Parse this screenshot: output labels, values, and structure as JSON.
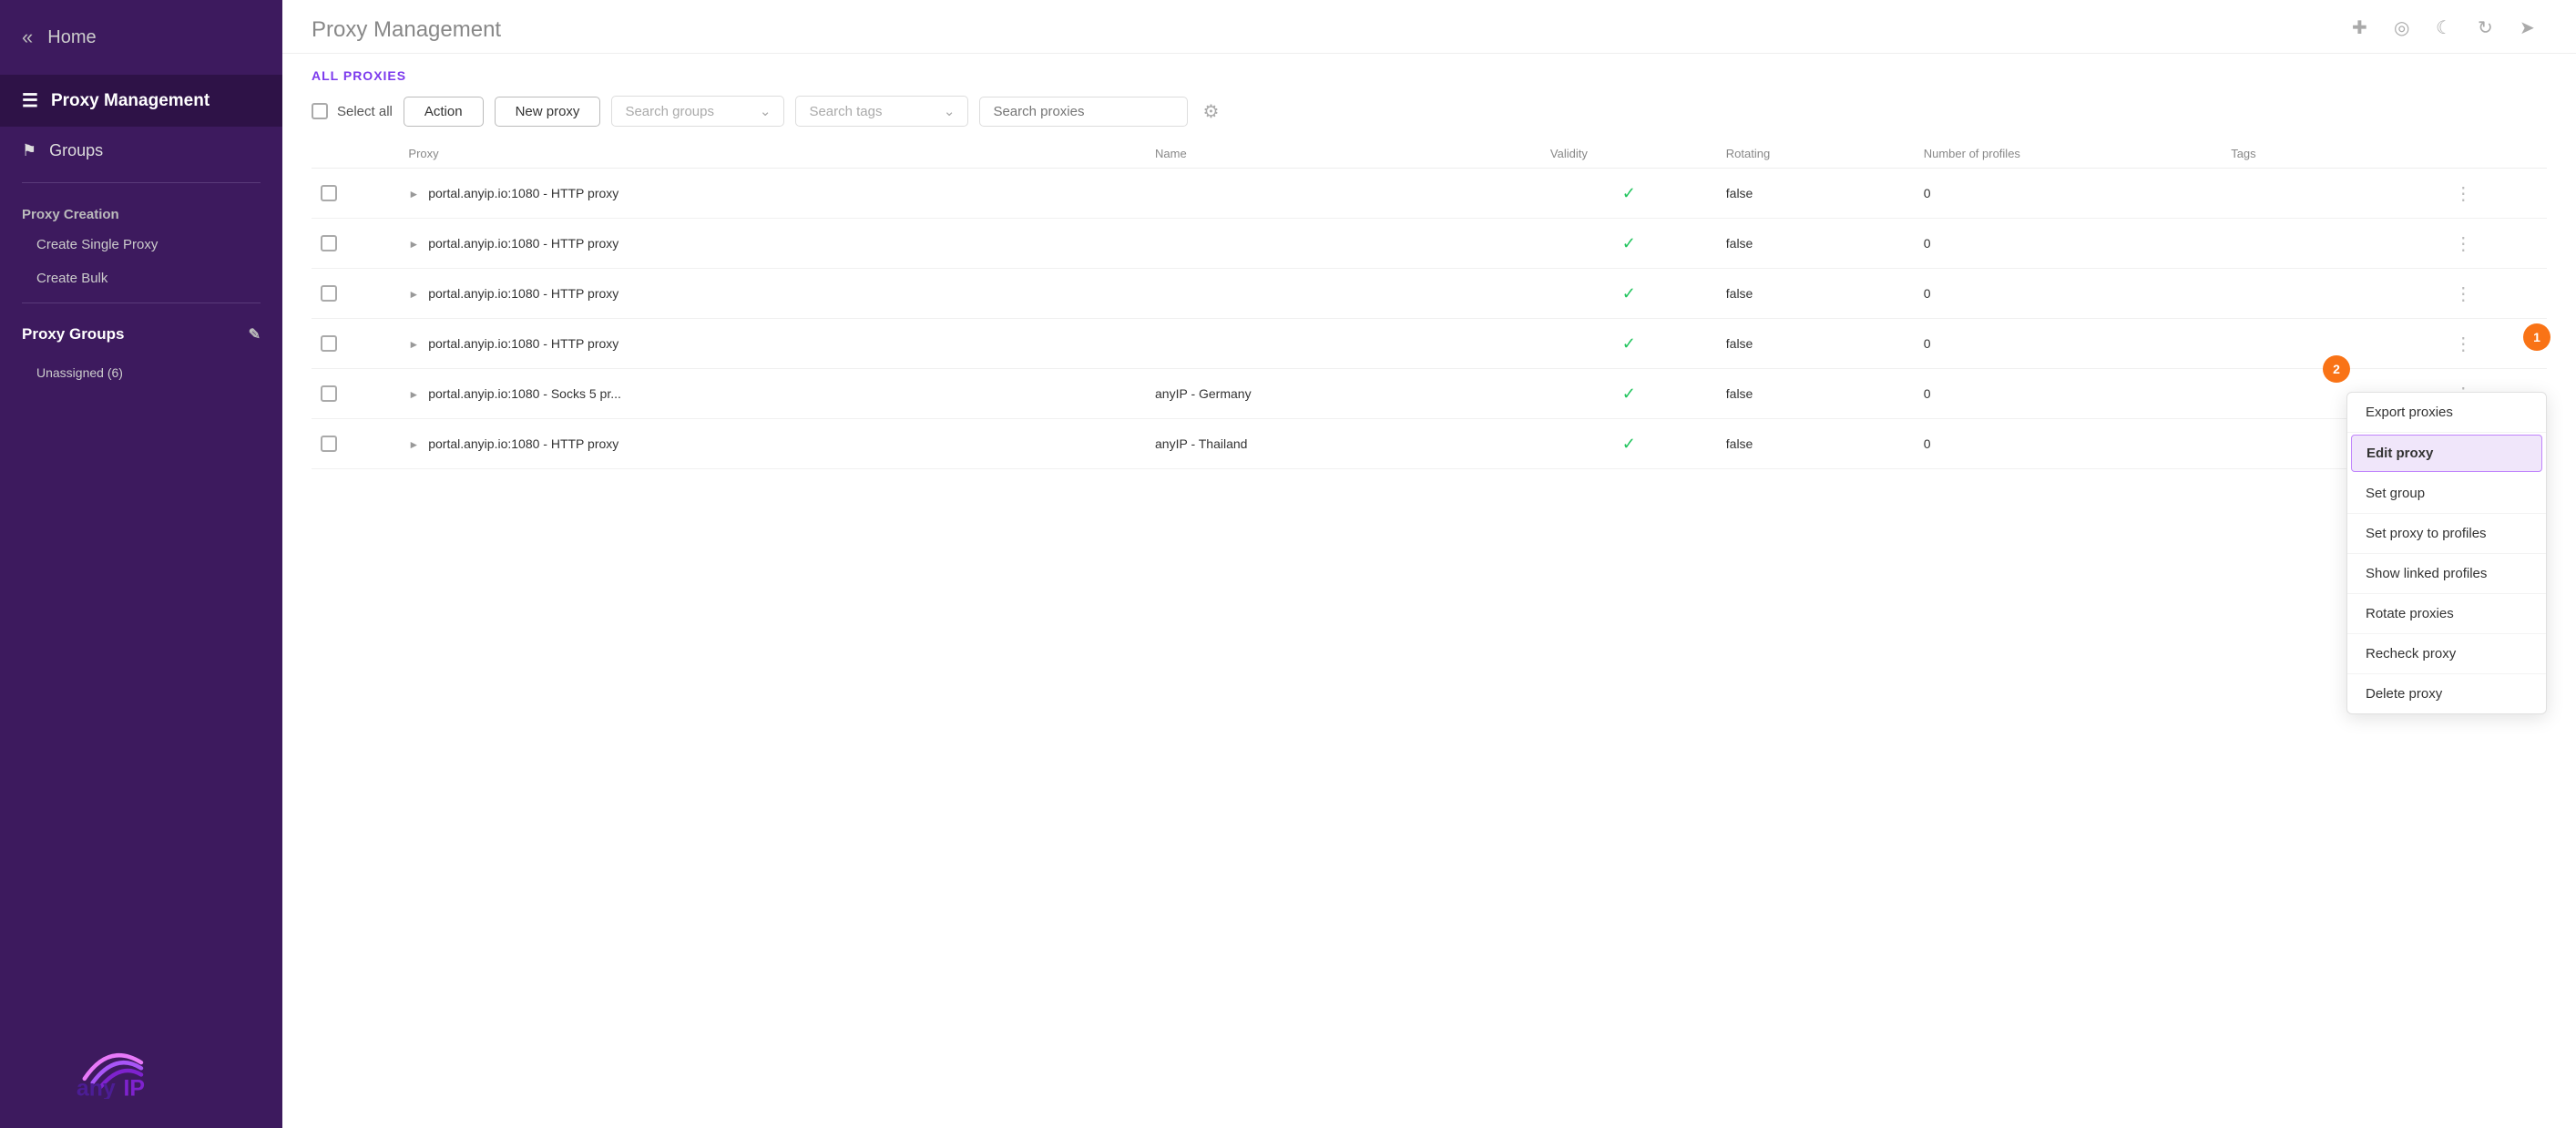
{
  "sidebar": {
    "home_label": "Home",
    "proxy_management_label": "Proxy Management",
    "groups_label": "Groups",
    "proxy_creation_label": "Proxy Creation",
    "create_single_label": "Create Single Proxy",
    "create_bulk_label": "Create Bulk",
    "proxy_groups_label": "Proxy Groups",
    "unassigned_label": "Unassigned (6)"
  },
  "header": {
    "title": "Proxy Management"
  },
  "section": {
    "label": "ALL PROXIES"
  },
  "toolbar": {
    "select_all": "Select all",
    "action_btn": "Action",
    "new_proxy_btn": "New proxy",
    "search_groups_placeholder": "Search groups",
    "search_tags_placeholder": "Search tags",
    "search_proxies_placeholder": "Search proxies"
  },
  "table": {
    "columns": [
      "Proxy",
      "Name",
      "Validity",
      "Rotating",
      "Number of profiles",
      "Tags"
    ],
    "rows": [
      {
        "proxy": "portal.anyip.io:1080 - HTTP proxy",
        "name": "",
        "validity": true,
        "rotating": "false",
        "profiles": "0",
        "tags": ""
      },
      {
        "proxy": "portal.anyip.io:1080 - HTTP proxy",
        "name": "",
        "validity": true,
        "rotating": "false",
        "profiles": "0",
        "tags": ""
      },
      {
        "proxy": "portal.anyip.io:1080 - HTTP proxy",
        "name": "",
        "validity": true,
        "rotating": "false",
        "profiles": "0",
        "tags": ""
      },
      {
        "proxy": "portal.anyip.io:1080 - HTTP proxy",
        "name": "",
        "validity": true,
        "rotating": "false",
        "profiles": "0",
        "tags": ""
      },
      {
        "proxy": "portal.anyip.io:1080 - Socks 5 pr...",
        "name": "anyIP - Germany",
        "validity": true,
        "rotating": "false",
        "profiles": "0",
        "tags": ""
      },
      {
        "proxy": "portal.anyip.io:1080 - HTTP proxy",
        "name": "anyIP - Thailand",
        "validity": true,
        "rotating": "false",
        "profiles": "0",
        "tags": ""
      }
    ]
  },
  "context_menu": {
    "items": [
      {
        "label": "Export proxies",
        "active": false
      },
      {
        "label": "Edit proxy",
        "active": true
      },
      {
        "label": "Set group",
        "active": false
      },
      {
        "label": "Set proxy to profiles",
        "active": false
      },
      {
        "label": "Show linked profiles",
        "active": false
      },
      {
        "label": "Rotate proxies",
        "active": false
      },
      {
        "label": "Recheck proxy",
        "active": false
      },
      {
        "label": "Delete proxy",
        "active": false
      }
    ]
  },
  "badges": {
    "badge1": "1",
    "badge2": "2"
  },
  "logo": {
    "text": "anyIP"
  }
}
